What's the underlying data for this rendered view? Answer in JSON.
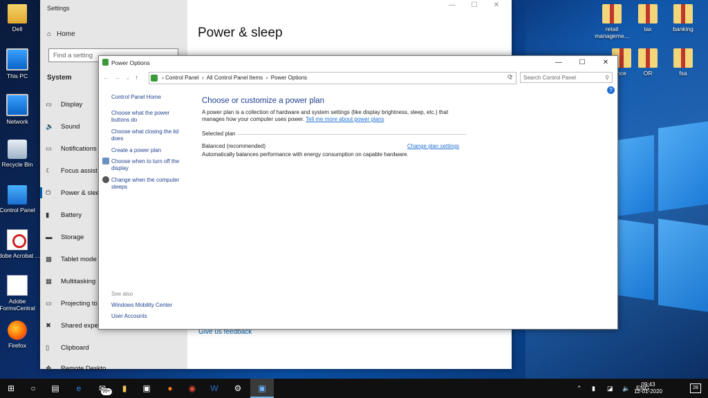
{
  "desktop": {
    "left_icons": [
      {
        "label": "Dell",
        "img": "folder-user"
      },
      {
        "label": "This PC",
        "img": "pc"
      },
      {
        "label": "Network",
        "img": "network"
      },
      {
        "label": "Recycle Bin",
        "img": "bin"
      },
      {
        "label": "Control Panel",
        "img": "control-panel"
      },
      {
        "label": "Adobe Acrobat ...",
        "img": "pdf"
      },
      {
        "label": "Adobe FormsCentral",
        "img": "forms"
      },
      {
        "label": "Firefox",
        "img": "firefox"
      }
    ],
    "right_icons": [
      {
        "label": "retail manageme...",
        "img": "zip"
      },
      {
        "label": "tax",
        "img": "zip"
      },
      {
        "label": "banking",
        "img": "zip"
      },
      {
        "label": "nce",
        "img": "zip"
      },
      {
        "label": "OR",
        "img": "zip"
      },
      {
        "label": "fsa",
        "img": "zip"
      }
    ]
  },
  "settings": {
    "title": "Settings",
    "home": "Home",
    "search_placeholder": "Find a setting",
    "section": "System",
    "nav": [
      {
        "label": "Display",
        "icon": "display-icon"
      },
      {
        "label": "Sound",
        "icon": "sound-icon"
      },
      {
        "label": "Notifications",
        "icon": "notifications-icon"
      },
      {
        "label": "Focus assist",
        "icon": "focus-icon"
      },
      {
        "label": "Power & slee",
        "icon": "power-icon"
      },
      {
        "label": "Battery",
        "icon": "battery-icon"
      },
      {
        "label": "Storage",
        "icon": "storage-icon"
      },
      {
        "label": "Tablet mode",
        "icon": "tablet-icon"
      },
      {
        "label": "Multitasking",
        "icon": "multitasking-icon"
      },
      {
        "label": "Projecting to",
        "icon": "projecting-icon"
      },
      {
        "label": "Shared exper",
        "icon": "shared-icon"
      },
      {
        "label": "Clipboard",
        "icon": "clipboard-icon"
      },
      {
        "label": "Remote Deskto",
        "icon": "remote-icon"
      }
    ],
    "heading": "Power & sleep",
    "feedback": "Give us feedback"
  },
  "power_options": {
    "title": "Power Options",
    "breadcrumb": [
      "Control Panel",
      "All Control Panel Items",
      "Power Options"
    ],
    "search_placeholder": "Search Control Panel",
    "sidebar": {
      "home": "Control Panel Home",
      "links": [
        "Choose what the power buttons do",
        "Choose what closing the lid does",
        "Create a power plan",
        "Choose when to turn off the display",
        "Change when the computer sleeps"
      ],
      "see_also": "See also",
      "see_also_links": [
        "Windows Mobility Center",
        "User Accounts"
      ]
    },
    "heading": "Choose or customize a power plan",
    "description": "A power plan is a collection of hardware and system settings (like display brightness, sleep, etc.) that manages how your computer uses power.",
    "description_link": "Tell me more about power plans",
    "selected_plan_label": "Selected plan",
    "plan_name": "Balanced (recommended)",
    "plan_link": "Change plan settings",
    "plan_desc": "Automatically balances performance with energy consumption on capable hardware."
  },
  "taskbar": {
    "badge": "99+",
    "lang": "ENG",
    "time": "09:43",
    "date": "12-01-2020",
    "notifications": "28"
  }
}
